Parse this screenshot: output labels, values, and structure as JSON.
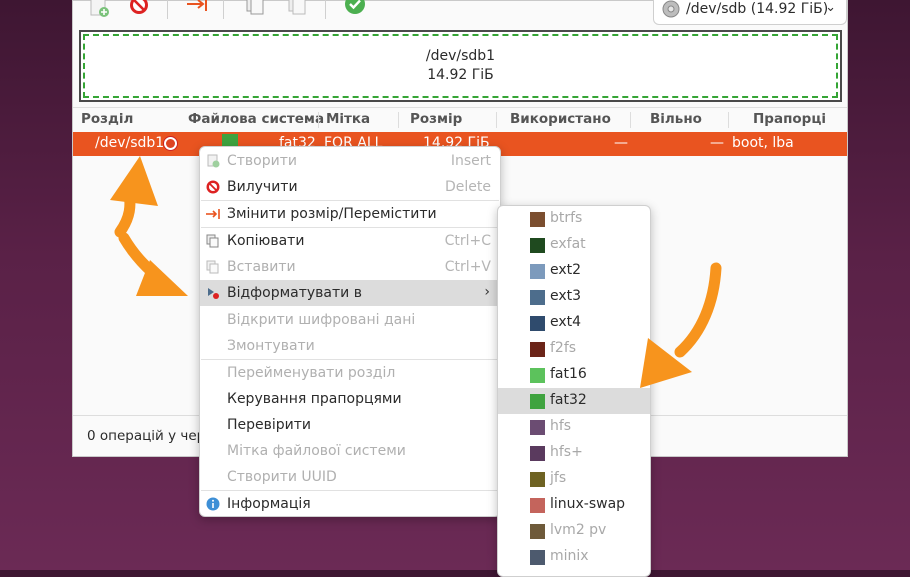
{
  "colors": {
    "accent": "#e95420",
    "arrow": "#f7941d",
    "fat32_swatch": "#3fa33f"
  },
  "device_selector": {
    "label": "/dev/sdb (14.92 ГіБ)",
    "icon": "disk-icon"
  },
  "partition_map": {
    "name": "/dev/sdb1",
    "size": "14.92 ГіБ"
  },
  "table": {
    "headers": [
      "Розділ",
      "Файлова система",
      "Мітка",
      "Розмір",
      "Використано",
      "Вільно",
      "Прапорці"
    ],
    "rows": [
      {
        "partition": "/dev/sdb1",
        "filesystem": "fat32",
        "label": "FOR ALL",
        "size": "14.92 ГіБ",
        "used": "—",
        "free": "—",
        "flags": "boot, lba"
      }
    ]
  },
  "status": "0 операцій у черзі",
  "context_menu": [
    {
      "label": "Створити",
      "accel": "Insert",
      "icon": "new-partition-icon",
      "disabled": true
    },
    {
      "label": "Вилучити",
      "accel": "Delete",
      "icon": "delete-icon",
      "disabled": false
    },
    {
      "label": "Змінити розмір/Перемістити",
      "accel": "",
      "icon": "resize-icon",
      "disabled": false
    },
    {
      "label": "Копіювати",
      "accel": "Ctrl+C",
      "icon": "copy-icon",
      "disabled": false
    },
    {
      "label": "Вставити",
      "accel": "Ctrl+V",
      "icon": "paste-icon",
      "disabled": true
    },
    {
      "label": "Відформатувати в",
      "accel": "",
      "icon": "format-icon",
      "disabled": false,
      "highlighted": true,
      "submenu": true
    },
    {
      "label": "Відкрити шифровані дані",
      "accel": "",
      "icon": "",
      "disabled": true
    },
    {
      "label": "Змонтувати",
      "accel": "",
      "icon": "",
      "disabled": true
    },
    {
      "label": "Перейменувати розділ",
      "accel": "",
      "icon": "",
      "disabled": true
    },
    {
      "label": "Керування прапорцями",
      "accel": "",
      "icon": "",
      "disabled": false
    },
    {
      "label": "Перевірити",
      "accel": "",
      "icon": "",
      "disabled": false
    },
    {
      "label": "Мітка файлової системи",
      "accel": "",
      "icon": "",
      "disabled": true
    },
    {
      "label": "Створити UUID",
      "accel": "",
      "icon": "",
      "disabled": true
    },
    {
      "label": "Інформація",
      "accel": "",
      "icon": "info-icon",
      "disabled": false
    }
  ],
  "format_submenu": [
    {
      "label": "btrfs",
      "color": "#7b4e2f",
      "disabled": true
    },
    {
      "label": "exfat",
      "color": "#1f4a1f",
      "disabled": true
    },
    {
      "label": "ext2",
      "color": "#7c9abc",
      "disabled": false
    },
    {
      "label": "ext3",
      "color": "#4d6d8c",
      "disabled": false
    },
    {
      "label": "ext4",
      "color": "#2f4b6d",
      "disabled": false
    },
    {
      "label": "f2fs",
      "color": "#6b2418",
      "disabled": true
    },
    {
      "label": "fat16",
      "color": "#5cc25c",
      "disabled": false
    },
    {
      "label": "fat32",
      "color": "#3fa33f",
      "disabled": false,
      "highlighted": true
    },
    {
      "label": "hfs",
      "color": "#6b4c72",
      "disabled": true
    },
    {
      "label": "hfs+",
      "color": "#5a3a5e",
      "disabled": true
    },
    {
      "label": "jfs",
      "color": "#6e6222",
      "disabled": true
    },
    {
      "label": "linux-swap",
      "color": "#c4645c",
      "disabled": false
    },
    {
      "label": "lvm2 pv",
      "color": "#6e5a3a",
      "disabled": true
    },
    {
      "label": "minix",
      "color": "#4d5a6e",
      "disabled": true
    }
  ]
}
